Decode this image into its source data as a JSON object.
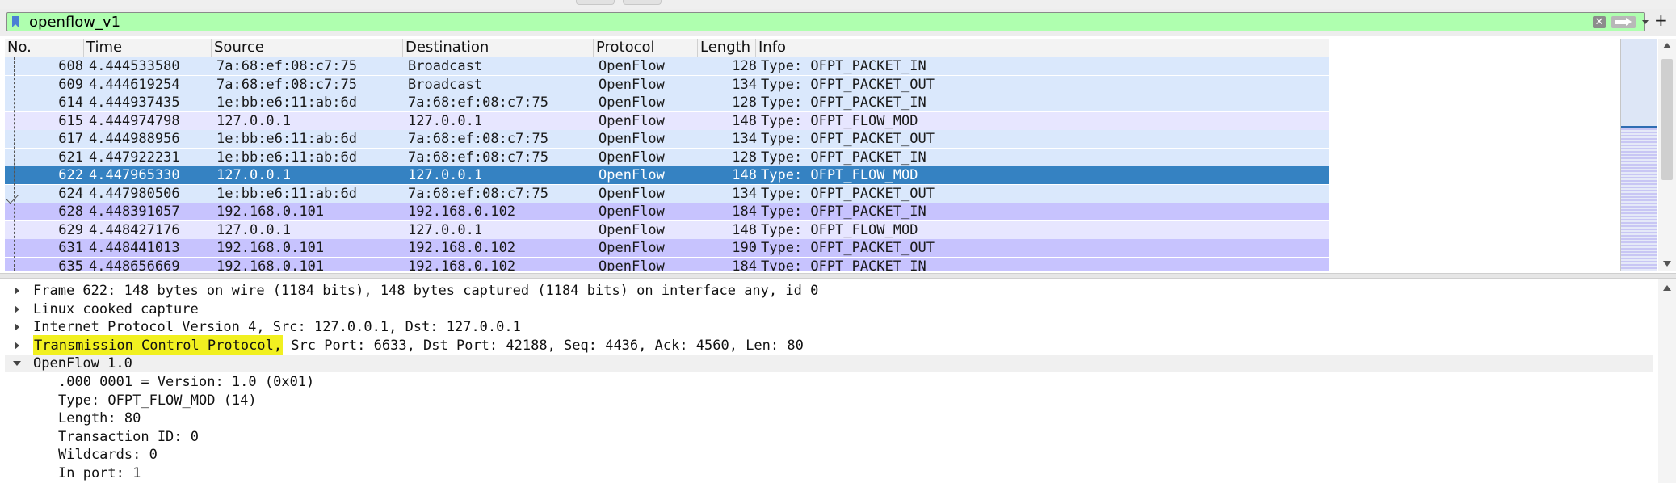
{
  "filter": {
    "value": "openflow_v1"
  },
  "packet_list": {
    "columns": [
      "No.",
      "Time",
      "Source",
      "Destination",
      "Protocol",
      "Length",
      "Info"
    ],
    "rows": [
      {
        "no": "608",
        "time": "4.444533580",
        "source": "7a:68:ef:08:c7:75",
        "destination": "Broadcast",
        "protocol": "OpenFlow",
        "length": "128",
        "info": "Type: OFPT_PACKET_IN",
        "color": "#dae8fc"
      },
      {
        "no": "609",
        "time": "4.444619254",
        "source": "7a:68:ef:08:c7:75",
        "destination": "Broadcast",
        "protocol": "OpenFlow",
        "length": "134",
        "info": "Type: OFPT_PACKET_OUT",
        "color": "#dae8fc"
      },
      {
        "no": "614",
        "time": "4.444937435",
        "source": "1e:bb:e6:11:ab:6d",
        "destination": "7a:68:ef:08:c7:75",
        "protocol": "OpenFlow",
        "length": "128",
        "info": "Type: OFPT_PACKET_IN",
        "color": "#dae8fc"
      },
      {
        "no": "615",
        "time": "4.444974798",
        "source": "127.0.0.1",
        "destination": "127.0.0.1",
        "protocol": "OpenFlow",
        "length": "148",
        "info": "Type: OFPT_FLOW_MOD",
        "color": "#e7e6ff"
      },
      {
        "no": "617",
        "time": "4.444988956",
        "source": "1e:bb:e6:11:ab:6d",
        "destination": "7a:68:ef:08:c7:75",
        "protocol": "OpenFlow",
        "length": "134",
        "info": "Type: OFPT_PACKET_OUT",
        "color": "#dae8fc"
      },
      {
        "no": "621",
        "time": "4.447922231",
        "source": "1e:bb:e6:11:ab:6d",
        "destination": "7a:68:ef:08:c7:75",
        "protocol": "OpenFlow",
        "length": "128",
        "info": "Type: OFPT_PACKET_IN",
        "color": "#dae8fc"
      },
      {
        "no": "622",
        "time": "4.447965330",
        "source": "127.0.0.1",
        "destination": "127.0.0.1",
        "protocol": "OpenFlow",
        "length": "148",
        "info": "Type: OFPT_FLOW_MOD",
        "color": "#3582c2",
        "selected": true
      },
      {
        "no": "624",
        "time": "4.447980506",
        "source": "1e:bb:e6:11:ab:6d",
        "destination": "7a:68:ef:08:c7:75",
        "protocol": "OpenFlow",
        "length": "134",
        "info": "Type: OFPT_PACKET_OUT",
        "color": "#dae8fc"
      },
      {
        "no": "628",
        "time": "4.448391057",
        "source": "192.168.0.101",
        "destination": "192.168.0.102",
        "protocol": "OpenFlow",
        "length": "184",
        "info": "Type: OFPT_PACKET_IN",
        "color": "#c7c3fe"
      },
      {
        "no": "629",
        "time": "4.448427176",
        "source": "127.0.0.1",
        "destination": "127.0.0.1",
        "protocol": "OpenFlow",
        "length": "148",
        "info": "Type: OFPT_FLOW_MOD",
        "color": "#e7e6ff"
      },
      {
        "no": "631",
        "time": "4.448441013",
        "source": "192.168.0.101",
        "destination": "192.168.0.102",
        "protocol": "OpenFlow",
        "length": "190",
        "info": "Type: OFPT_PACKET_OUT",
        "color": "#c7c3fe"
      },
      {
        "no": "635",
        "time": "4.448656669",
        "source": "192.168.0.101",
        "destination": "192.168.0.102",
        "protocol": "OpenFlow",
        "length": "184",
        "info": "Type: OFPT_PACKET_IN",
        "color": "#c7c3fe"
      }
    ]
  },
  "details": {
    "rows": [
      {
        "text": "Frame 622: 148 bytes on wire (1184 bits), 148 bytes captured (1184 bits) on interface any, id 0",
        "expander": "collapsed",
        "indent": 0
      },
      {
        "text": "Linux cooked capture",
        "expander": "collapsed",
        "indent": 0
      },
      {
        "text": "Internet Protocol Version 4, Src: 127.0.0.1, Dst: 127.0.0.1",
        "expander": "collapsed",
        "indent": 0
      },
      {
        "text_highlight": "Transmission Control Protocol,",
        "text": " Src Port: 6633, Dst Port: 42188, Seq: 4436, Ack: 4560, Len: 80",
        "expander": "collapsed",
        "indent": 0
      },
      {
        "text": "OpenFlow 1.0",
        "expander": "expanded",
        "indent": 0
      },
      {
        "text": ".000 0001 = Version: 1.0 (0x01)",
        "expander": "none",
        "indent": 1
      },
      {
        "text": "Type: OFPT_FLOW_MOD (14)",
        "expander": "none",
        "indent": 1
      },
      {
        "text": "Length: 80",
        "expander": "none",
        "indent": 1
      },
      {
        "text": "Transaction ID: 0",
        "expander": "none",
        "indent": 1
      },
      {
        "text": "Wildcards: 0",
        "expander": "none",
        "indent": 1
      },
      {
        "text": "In port: 1",
        "expander": "none",
        "indent": 1
      }
    ]
  },
  "icons": {
    "bookmark": "bookmark-icon",
    "clear": "clear-filter-icon",
    "apply": "apply-filter-icon",
    "dropdown": "filter-dropdown-icon",
    "add": "add-filter-button-icon",
    "plus_glyph": "+",
    "clear_glyph": "✕"
  },
  "colors": {
    "filter_valid_bg": "#afffaf",
    "selected_row": "#3582c2",
    "highlight": "#f1f020"
  }
}
